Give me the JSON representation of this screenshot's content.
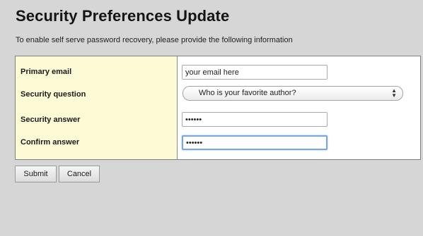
{
  "header": {
    "title": "Security Preferences Update",
    "subtitle": "To enable self serve password recovery, please provide the following information"
  },
  "form": {
    "primary_email": {
      "label": "Primary email",
      "value": "your email here"
    },
    "security_question": {
      "label": "Security question",
      "selected": "Who is your favorite author?"
    },
    "security_answer": {
      "label": "Security answer",
      "value": "••••••"
    },
    "confirm_answer": {
      "label": "Confirm answer",
      "value": "••••••"
    }
  },
  "buttons": {
    "submit_label": "Submit",
    "cancel_label": "Cancel"
  },
  "colors": {
    "label_column_bg": "#fdfbd6",
    "page_bg": "#d6d6d6",
    "focus_ring": "#7ba7d8"
  }
}
